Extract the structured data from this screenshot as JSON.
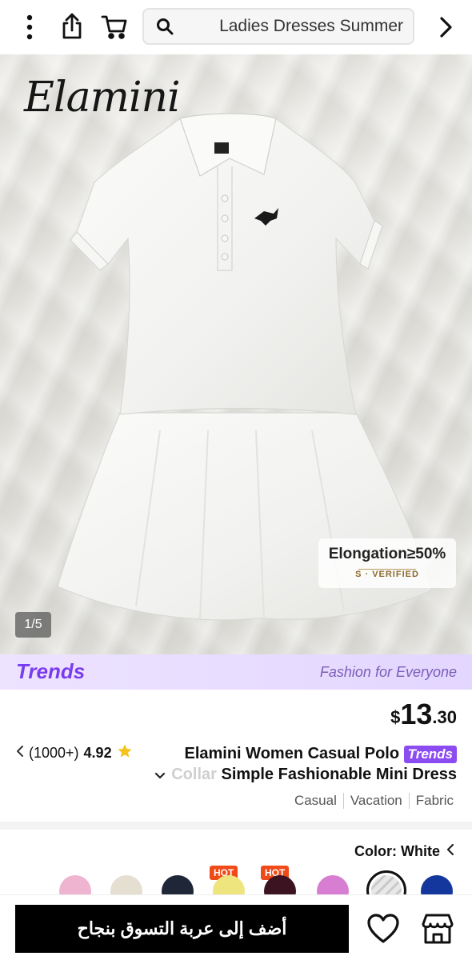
{
  "topbar": {
    "icons": [
      "more-vertical-icon",
      "share-icon",
      "cart-icon",
      "search-icon",
      "chevron-right-icon"
    ],
    "search_text": "Ladies Dresses Summer"
  },
  "gallery": {
    "brand_logo_text": "Elamini",
    "badge_title": "Elongation≥50%",
    "badge_sub": "S · VERIFIED",
    "counter": "1/5"
  },
  "trends_banner": {
    "logo": "Trends",
    "tagline": "Fashion for Everyone"
  },
  "product": {
    "price_currency": "$",
    "price_whole": "13",
    "price_cents": ".30",
    "rating": "4.92",
    "reviews": "(1000+)",
    "title_line1": "Elamini Women Casual Polo",
    "trends_badge": "Trends",
    "title_line2_faded": "Collar",
    "title_line2": " Simple Fashionable Mini Dress",
    "tags": [
      "Casual",
      "Vacation",
      "Fabric"
    ]
  },
  "color": {
    "label": "Color: White",
    "swatches": [
      {
        "name": "pink",
        "hex": "#efb4cf",
        "hot": false
      },
      {
        "name": "beige",
        "hex": "#e4dfd1",
        "hot": false
      },
      {
        "name": "navy",
        "hex": "#1e2637",
        "hot": false
      },
      {
        "name": "yellow",
        "hex": "#eee57f",
        "hot": true
      },
      {
        "name": "burgundy",
        "hex": "#3b1321",
        "hot": true
      },
      {
        "name": "orchid",
        "hex": "#d77ed3",
        "hot": false
      },
      {
        "name": "white",
        "hex": "#dcdcdc",
        "hot": false,
        "selected": true
      },
      {
        "name": "blue",
        "hex": "#13379c",
        "hot": false
      }
    ],
    "hot_label": "HOT"
  },
  "bottom_bar": {
    "add_to_cart": "أضف إلى عربة التسوق بنجاح",
    "icons": [
      "heart-icon",
      "store-icon"
    ]
  },
  "colors": {
    "accent": "#8b4cf2",
    "hot": "#f04a18",
    "primary_button": "#000000"
  }
}
